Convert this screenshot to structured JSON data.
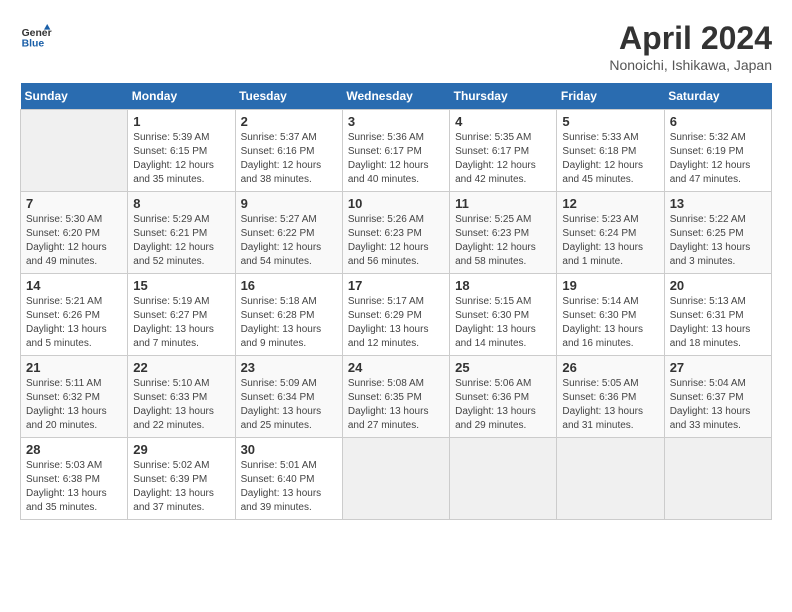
{
  "header": {
    "logo_general": "General",
    "logo_blue": "Blue",
    "month_year": "April 2024",
    "location": "Nonoichi, Ishikawa, Japan"
  },
  "calendar": {
    "days_of_week": [
      "Sunday",
      "Monday",
      "Tuesday",
      "Wednesday",
      "Thursday",
      "Friday",
      "Saturday"
    ],
    "weeks": [
      [
        {
          "day": "",
          "info": ""
        },
        {
          "day": "1",
          "info": "Sunrise: 5:39 AM\nSunset: 6:15 PM\nDaylight: 12 hours\nand 35 minutes."
        },
        {
          "day": "2",
          "info": "Sunrise: 5:37 AM\nSunset: 6:16 PM\nDaylight: 12 hours\nand 38 minutes."
        },
        {
          "day": "3",
          "info": "Sunrise: 5:36 AM\nSunset: 6:17 PM\nDaylight: 12 hours\nand 40 minutes."
        },
        {
          "day": "4",
          "info": "Sunrise: 5:35 AM\nSunset: 6:17 PM\nDaylight: 12 hours\nand 42 minutes."
        },
        {
          "day": "5",
          "info": "Sunrise: 5:33 AM\nSunset: 6:18 PM\nDaylight: 12 hours\nand 45 minutes."
        },
        {
          "day": "6",
          "info": "Sunrise: 5:32 AM\nSunset: 6:19 PM\nDaylight: 12 hours\nand 47 minutes."
        }
      ],
      [
        {
          "day": "7",
          "info": "Sunrise: 5:30 AM\nSunset: 6:20 PM\nDaylight: 12 hours\nand 49 minutes."
        },
        {
          "day": "8",
          "info": "Sunrise: 5:29 AM\nSunset: 6:21 PM\nDaylight: 12 hours\nand 52 minutes."
        },
        {
          "day": "9",
          "info": "Sunrise: 5:27 AM\nSunset: 6:22 PM\nDaylight: 12 hours\nand 54 minutes."
        },
        {
          "day": "10",
          "info": "Sunrise: 5:26 AM\nSunset: 6:23 PM\nDaylight: 12 hours\nand 56 minutes."
        },
        {
          "day": "11",
          "info": "Sunrise: 5:25 AM\nSunset: 6:23 PM\nDaylight: 12 hours\nand 58 minutes."
        },
        {
          "day": "12",
          "info": "Sunrise: 5:23 AM\nSunset: 6:24 PM\nDaylight: 13 hours\nand 1 minute."
        },
        {
          "day": "13",
          "info": "Sunrise: 5:22 AM\nSunset: 6:25 PM\nDaylight: 13 hours\nand 3 minutes."
        }
      ],
      [
        {
          "day": "14",
          "info": "Sunrise: 5:21 AM\nSunset: 6:26 PM\nDaylight: 13 hours\nand 5 minutes."
        },
        {
          "day": "15",
          "info": "Sunrise: 5:19 AM\nSunset: 6:27 PM\nDaylight: 13 hours\nand 7 minutes."
        },
        {
          "day": "16",
          "info": "Sunrise: 5:18 AM\nSunset: 6:28 PM\nDaylight: 13 hours\nand 9 minutes."
        },
        {
          "day": "17",
          "info": "Sunrise: 5:17 AM\nSunset: 6:29 PM\nDaylight: 13 hours\nand 12 minutes."
        },
        {
          "day": "18",
          "info": "Sunrise: 5:15 AM\nSunset: 6:30 PM\nDaylight: 13 hours\nand 14 minutes."
        },
        {
          "day": "19",
          "info": "Sunrise: 5:14 AM\nSunset: 6:30 PM\nDaylight: 13 hours\nand 16 minutes."
        },
        {
          "day": "20",
          "info": "Sunrise: 5:13 AM\nSunset: 6:31 PM\nDaylight: 13 hours\nand 18 minutes."
        }
      ],
      [
        {
          "day": "21",
          "info": "Sunrise: 5:11 AM\nSunset: 6:32 PM\nDaylight: 13 hours\nand 20 minutes."
        },
        {
          "day": "22",
          "info": "Sunrise: 5:10 AM\nSunset: 6:33 PM\nDaylight: 13 hours\nand 22 minutes."
        },
        {
          "day": "23",
          "info": "Sunrise: 5:09 AM\nSunset: 6:34 PM\nDaylight: 13 hours\nand 25 minutes."
        },
        {
          "day": "24",
          "info": "Sunrise: 5:08 AM\nSunset: 6:35 PM\nDaylight: 13 hours\nand 27 minutes."
        },
        {
          "day": "25",
          "info": "Sunrise: 5:06 AM\nSunset: 6:36 PM\nDaylight: 13 hours\nand 29 minutes."
        },
        {
          "day": "26",
          "info": "Sunrise: 5:05 AM\nSunset: 6:36 PM\nDaylight: 13 hours\nand 31 minutes."
        },
        {
          "day": "27",
          "info": "Sunrise: 5:04 AM\nSunset: 6:37 PM\nDaylight: 13 hours\nand 33 minutes."
        }
      ],
      [
        {
          "day": "28",
          "info": "Sunrise: 5:03 AM\nSunset: 6:38 PM\nDaylight: 13 hours\nand 35 minutes."
        },
        {
          "day": "29",
          "info": "Sunrise: 5:02 AM\nSunset: 6:39 PM\nDaylight: 13 hours\nand 37 minutes."
        },
        {
          "day": "30",
          "info": "Sunrise: 5:01 AM\nSunset: 6:40 PM\nDaylight: 13 hours\nand 39 minutes."
        },
        {
          "day": "",
          "info": ""
        },
        {
          "day": "",
          "info": ""
        },
        {
          "day": "",
          "info": ""
        },
        {
          "day": "",
          "info": ""
        }
      ]
    ]
  }
}
